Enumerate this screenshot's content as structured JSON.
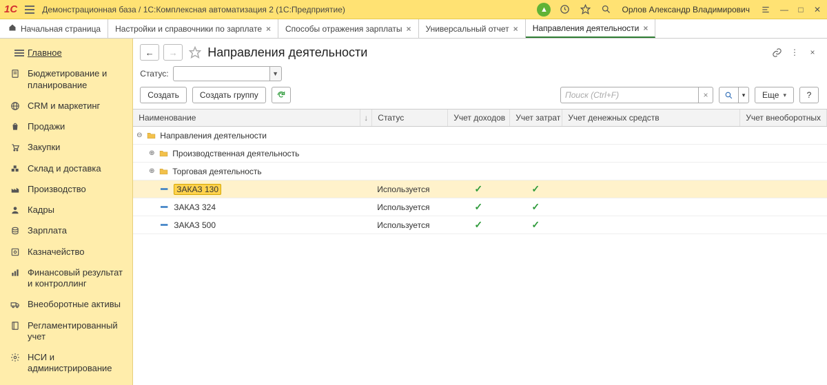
{
  "titlebar": {
    "title": "Демонстрационная база / 1С:Комплексная автоматизация 2  (1С:Предприятие)",
    "user": "Орлов Александр Владимирович"
  },
  "tabs": [
    {
      "label": "Начальная страница",
      "home": true
    },
    {
      "label": "Настройки и справочники по зарплате",
      "closable": true
    },
    {
      "label": "Способы отражения зарплаты",
      "closable": true
    },
    {
      "label": "Универсальный отчет",
      "closable": true
    },
    {
      "label": "Направления деятельности",
      "closable": true,
      "active": true
    }
  ],
  "sidebar": [
    {
      "icon": "menu",
      "label": "Главное",
      "current": true
    },
    {
      "icon": "clipboard",
      "label": "Бюджетирование и планирование"
    },
    {
      "icon": "globe",
      "label": "CRM и маркетинг"
    },
    {
      "icon": "bag",
      "label": "Продажи"
    },
    {
      "icon": "cart",
      "label": "Закупки"
    },
    {
      "icon": "boxes",
      "label": "Склад и доставка"
    },
    {
      "icon": "factory",
      "label": "Производство"
    },
    {
      "icon": "person",
      "label": "Кадры"
    },
    {
      "icon": "coins",
      "label": "Зарплата"
    },
    {
      "icon": "safe",
      "label": "Казначейство"
    },
    {
      "icon": "stats",
      "label": "Финансовый результат и контроллинг"
    },
    {
      "icon": "truck",
      "label": "Внеоборотные активы"
    },
    {
      "icon": "book",
      "label": "Регламентированный учет"
    },
    {
      "icon": "gear",
      "label": "НСИ и администрирование"
    }
  ],
  "page": {
    "title": "Направления деятельности",
    "status_label": "Статус:"
  },
  "toolbar": {
    "create": "Создать",
    "create_group": "Создать группу",
    "search_placeholder": "Поиск (Ctrl+F)",
    "more": "Еще"
  },
  "columns": {
    "name": "Наименование",
    "status": "Статус",
    "income": "Учет доходов",
    "expense": "Учет затрат",
    "cash": "Учет денежных средств",
    "fixed": "Учет внеоборотных"
  },
  "tree": {
    "root": "Направления деятельности",
    "groups": [
      {
        "label": "Производственная деятельность"
      },
      {
        "label": "Торговая деятельность"
      }
    ],
    "items": [
      {
        "name": "ЗАКАЗ 130",
        "status": "Используется",
        "income": true,
        "expense": true,
        "selected": true
      },
      {
        "name": "ЗАКАЗ 324",
        "status": "Используется",
        "income": true,
        "expense": true
      },
      {
        "name": "ЗАКАЗ 500",
        "status": "Используется",
        "income": true,
        "expense": true
      }
    ]
  }
}
